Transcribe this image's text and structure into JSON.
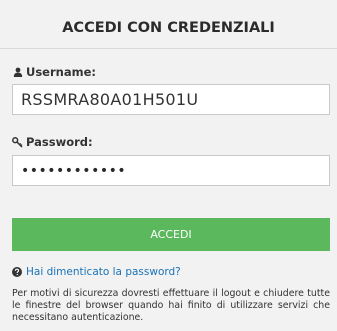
{
  "login": {
    "title": "ACCEDI CON CREDENZIALI",
    "username_label": "Username:",
    "username_value": "RSSMRA80A01H501U",
    "password_label": "Password:",
    "password_value": "••••••••••••",
    "submit_label": "ACCEDI",
    "forgot_label": "Hai dimenticato la password?",
    "notice": "Per motivi di sicurezza dovresti effettuare il logout e chiudere tutte le finestre del browser quando hai finito di utilizzare servizi che necessitano autenticazione."
  },
  "icons": {
    "username": "user-icon",
    "password": "key-icon",
    "forgot": "question-circle-icon"
  },
  "colors": {
    "panel_background": "#f2f2f2",
    "button": "#5cb85c",
    "link": "#1a73b8"
  }
}
